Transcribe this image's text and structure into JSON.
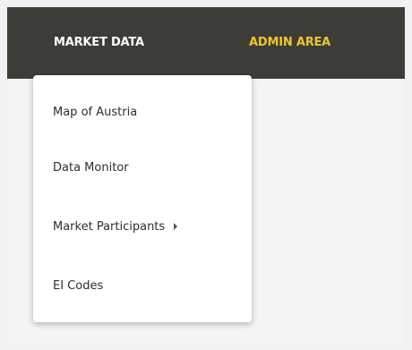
{
  "navbar": {
    "items": [
      {
        "label": "MARKET DATA"
      },
      {
        "label": "ADMIN AREA"
      }
    ],
    "colors": {
      "background": "#3d3c37",
      "text": "#ffffff",
      "accent": "#f0c430"
    }
  },
  "dropdown": {
    "items": [
      {
        "label": "Map of Austria"
      },
      {
        "label": "Data Monitor"
      },
      {
        "label": "Market Participants",
        "icon": "chevron-right-icon"
      },
      {
        "label": "EI Codes"
      }
    ]
  }
}
